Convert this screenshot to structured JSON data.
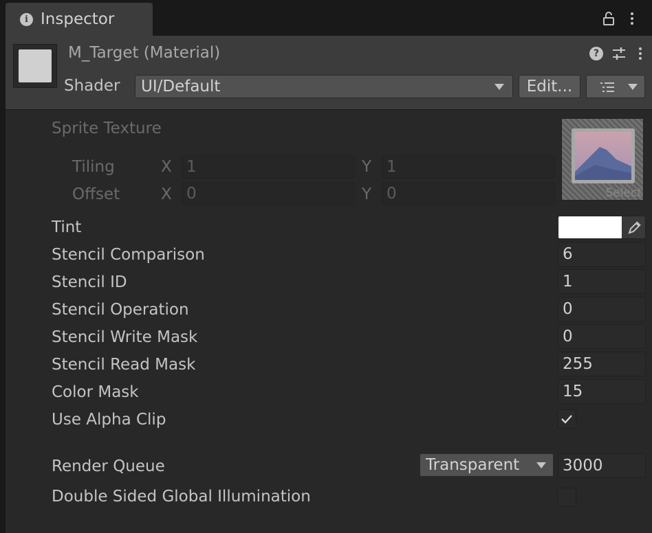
{
  "tab": {
    "title": "Inspector",
    "info_icon": "i"
  },
  "header": {
    "material_name": "M_Target (Material)",
    "shader_label": "Shader",
    "shader_value": "UI/Default",
    "edit_button": "Edit...",
    "help_glyph": "?"
  },
  "properties": {
    "sprite_texture": "Sprite Texture",
    "tiling": {
      "label": "Tiling",
      "x_axis": "X",
      "x": "1",
      "y_axis": "Y",
      "y": "1"
    },
    "offset": {
      "label": "Offset",
      "x_axis": "X",
      "x": "0",
      "y_axis": "Y",
      "y": "0"
    },
    "texture_select": "Select",
    "tint": {
      "label": "Tint",
      "color": "#FFFFFF"
    },
    "stencil_comparison": {
      "label": "Stencil Comparison",
      "value": "6"
    },
    "stencil_id": {
      "label": "Stencil ID",
      "value": "1"
    },
    "stencil_operation": {
      "label": "Stencil Operation",
      "value": "0"
    },
    "stencil_write_mask": {
      "label": "Stencil Write Mask",
      "value": "0"
    },
    "stencil_read_mask": {
      "label": "Stencil Read Mask",
      "value": "255"
    },
    "color_mask": {
      "label": "Color Mask",
      "value": "15"
    },
    "use_alpha_clip": {
      "label": "Use Alpha Clip",
      "checked": true
    },
    "render_queue": {
      "label": "Render Queue",
      "mode": "Transparent",
      "value": "3000"
    },
    "double_sided_gi": {
      "label": "Double Sided Global Illumination",
      "checked": false
    }
  },
  "colors": {
    "panel_bg": "#282828",
    "header_bg": "#3c3c3c",
    "field_bg": "#2a2a2a",
    "text": "#c4c4c4"
  }
}
